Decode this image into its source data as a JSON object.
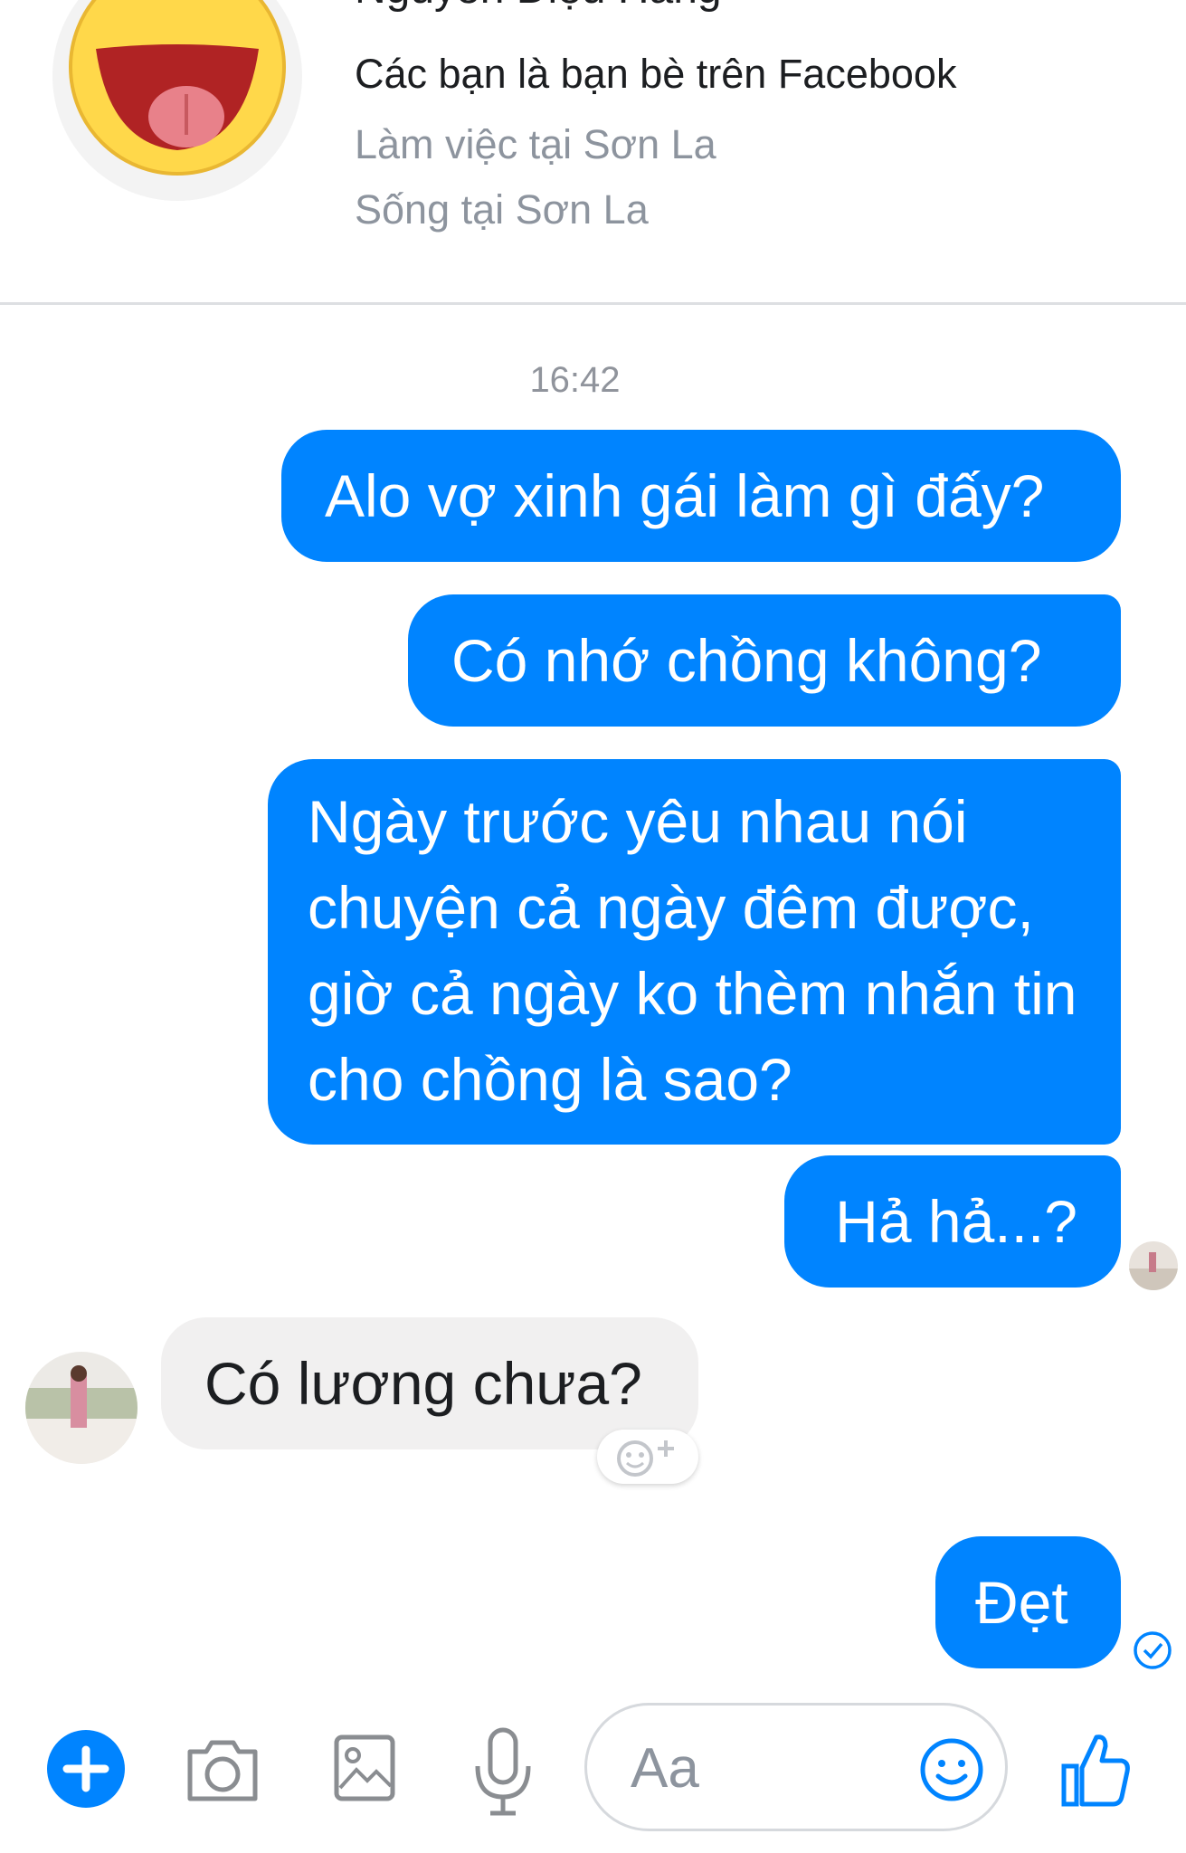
{
  "profile": {
    "name": "Nguyễn Diệu Hằng",
    "friend_status": "Các bạn là bạn bè trên Facebook",
    "work": "Làm việc tại Sơn La",
    "lives": "Sống tại Sơn La",
    "avatar_icon": "laughing-tongue-emoji"
  },
  "conversation": {
    "timestamp": "16:42",
    "messages_out": [
      "Alo vợ xinh gái làm gì đấy?",
      "Có nhớ chồng không?",
      "Ngày trước yêu nhau nói chuyện cả ngày đêm được, giờ cả ngày ko thèm nhắn tin cho chồng là sao?",
      "Hả hả...?"
    ],
    "message_in": "Có lương chưa?",
    "reply": "Đẹt"
  },
  "composer": {
    "placeholder": "Aa",
    "icons": [
      "plus-icon",
      "camera-icon",
      "image-icon",
      "microphone-icon",
      "emoji-icon",
      "thumbs-up-icon"
    ]
  },
  "colors": {
    "accent": "#0084ff",
    "incoming_bubble": "#f1f0f0",
    "muted_text": "#8d949e"
  }
}
